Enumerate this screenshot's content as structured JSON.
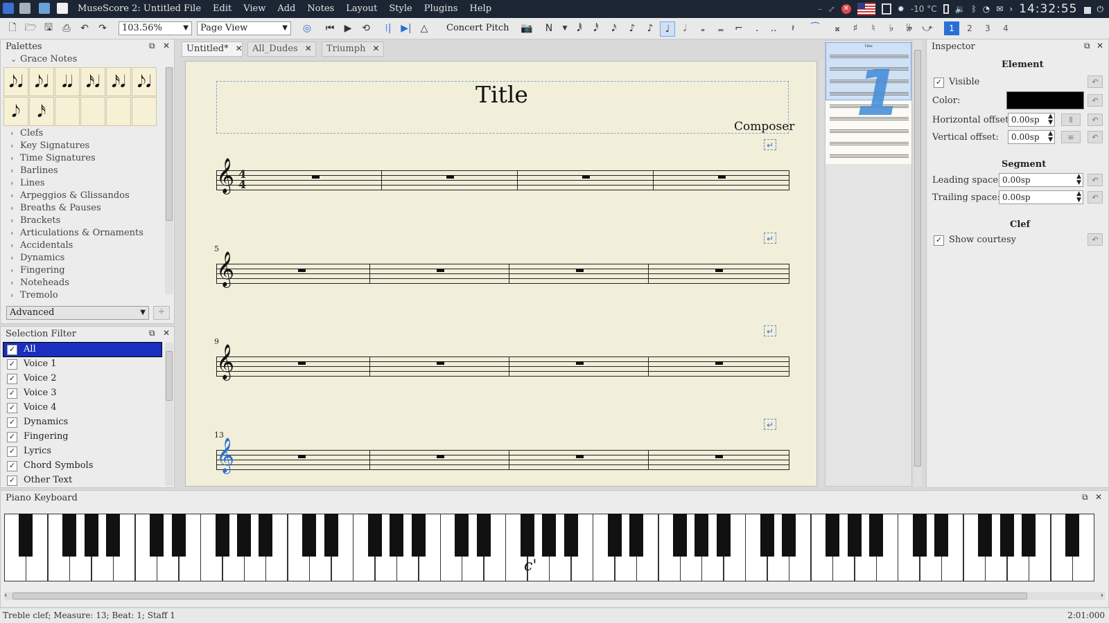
{
  "window": {
    "title": "MuseScore 2: Untitled",
    "menu": [
      "File",
      "Edit",
      "View",
      "Add",
      "Notes",
      "Layout",
      "Style",
      "Plugins",
      "Help"
    ]
  },
  "tray": {
    "temperature": "-10 °C",
    "clock": "14:32:55"
  },
  "toolbar": {
    "zoom": "103.56%",
    "view_mode": "Page View",
    "concert_pitch": "Concert Pitch",
    "voices": [
      "1",
      "2",
      "3",
      "4"
    ],
    "active_voice": "1"
  },
  "palettes": {
    "title": "Palettes",
    "open_section": "Grace Notes",
    "grace_cells": [
      "𝅘𝅥𝅮𝅘𝅥",
      "𝅘𝅥𝅮𝅘𝅥",
      "𝅘𝅥𝅘𝅥",
      "𝅘𝅥𝅯𝅘𝅥",
      "𝅘𝅥𝅯𝅘𝅥",
      "𝅘𝅥𝅮𝅘𝅥",
      "𝅘𝅥𝅮",
      "𝅘𝅥𝅯"
    ],
    "sections": [
      "Clefs",
      "Key Signatures",
      "Time Signatures",
      "Barlines",
      "Lines",
      "Arpeggios & Glissandos",
      "Breaths & Pauses",
      "Brackets",
      "Articulations & Ornaments",
      "Accidentals",
      "Dynamics",
      "Fingering",
      "Noteheads",
      "Tremolo"
    ],
    "workspace": "Advanced",
    "add_label": "+"
  },
  "selection_filter": {
    "title": "Selection Filter",
    "items": [
      "All",
      "Voice 1",
      "Voice 2",
      "Voice 3",
      "Voice 4",
      "Dynamics",
      "Fingering",
      "Lyrics",
      "Chord Symbols",
      "Other Text"
    ]
  },
  "tabs": [
    "Untitled*",
    "All_Dudes",
    "Triumph"
  ],
  "score": {
    "title": "Title",
    "composer": "Composer",
    "time_signature": "4/4",
    "systems": [
      {
        "measure_number": ""
      },
      {
        "measure_number": "5"
      },
      {
        "measure_number": "9"
      },
      {
        "measure_number": "13"
      }
    ]
  },
  "navigator": {
    "page_number": "1",
    "mini_title": "Title"
  },
  "inspector": {
    "title": "Inspector",
    "element_header": "Element",
    "visible_label": "Visible",
    "color_label": "Color:",
    "color_value": "#000000",
    "h_offset_label": "Horizontal offset:",
    "h_offset_value": "0.00sp",
    "v_offset_label": "Vertical offset:",
    "v_offset_value": "0.00sp",
    "segment_header": "Segment",
    "leading_label": "Leading space:",
    "leading_value": "0.00sp",
    "trailing_label": "Trailing space:",
    "trailing_value": "0.00sp",
    "clef_header": "Clef",
    "courtesy_label": "Show courtesy"
  },
  "piano": {
    "title": "Piano Keyboard",
    "middle_c_label": "c'"
  },
  "status": {
    "left": "Treble clef;  Measure: 13; Beat: 1; Staff 1",
    "right": "2:01:000"
  },
  "colors": {
    "accent": "#2a6fd6",
    "score_bg": "#f1efd9",
    "topbar": "#1c2533",
    "selection": "#1a2fbf"
  }
}
